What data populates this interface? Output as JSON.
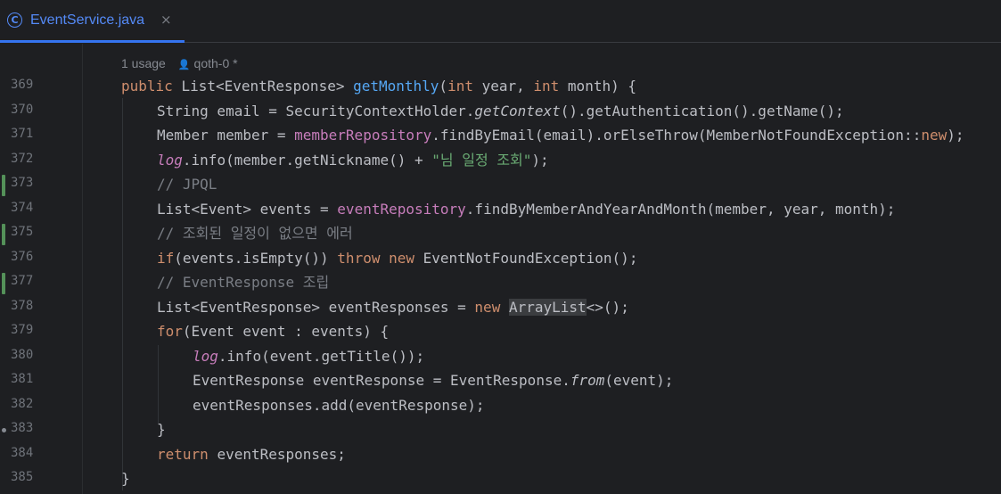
{
  "tab": {
    "icon_letter": "C",
    "title": "EventService.java",
    "close": "×"
  },
  "hint": {
    "usages": "1 usage",
    "person_icon": "person-icon",
    "author": "qoth-0 *"
  },
  "lines": {
    "l369": {
      "n": "369",
      "s1": "public ",
      "s2": "List<EventResponse> ",
      "s3": "getMonthly",
      "s4": "(",
      "s5": "int ",
      "s6": "year, ",
      "s7": "int ",
      "s8": "month) {"
    },
    "l370": {
      "n": "370",
      "s1": "String email = SecurityContextHolder.",
      "s2": "getContext",
      "s3": "().getAuthentication().getName();"
    },
    "l371": {
      "n": "371",
      "s1": "Member member = ",
      "s2": "memberRepository",
      "s3": ".findByEmail(email).orElseThrow(MemberNotFoundException::",
      "s4": "new",
      "s5": ");"
    },
    "l372": {
      "n": "372",
      "s1": "log",
      "s2": ".info(member.getNickname() + ",
      "s3": "\"님 일정 조회\"",
      "s4": ");"
    },
    "l373": {
      "n": "373",
      "s1": "// JPQL"
    },
    "l374": {
      "n": "374",
      "s1": "List<Event> events = ",
      "s2": "eventRepository",
      "s3": ".findByMemberAndYearAndMonth(member, year, month);"
    },
    "l375": {
      "n": "375",
      "s1": "// 조회된 일정이 없으면 에러"
    },
    "l376": {
      "n": "376",
      "s1": "if",
      "s2": "(events.isEmpty()) ",
      "s3": "throw ",
      "s4": "new ",
      "s5": "EventNotFoundException();"
    },
    "l377": {
      "n": "377",
      "s1": "// EventResponse 조립"
    },
    "l378": {
      "n": "378",
      "s1": "List<EventResponse> eventResponses = ",
      "s2": "new ",
      "s3": "ArrayList",
      "s4": "<>();"
    },
    "l379": {
      "n": "379",
      "s1": "for",
      "s2": "(Event event : events) {"
    },
    "l380": {
      "n": "380",
      "s1": "log",
      "s2": ".info(event.getTitle());"
    },
    "l381": {
      "n": "381",
      "s1": "EventResponse eventResponse = EventResponse.",
      "s2": "from",
      "s3": "(event);"
    },
    "l382": {
      "n": "382",
      "s1": "eventResponses.add(eventResponse);"
    },
    "l383": {
      "n": "383",
      "s1": "}"
    },
    "l384": {
      "n": "384",
      "s1": "return ",
      "s2": "eventResponses;"
    },
    "l385": {
      "n": "385",
      "s1": "}"
    }
  },
  "colors": {
    "background": "#1e1f22",
    "keyword": "#cf8e6d",
    "method_declaration": "#56a8f5",
    "field": "#c77dbb",
    "string": "#6aab73",
    "comment": "#7a7e85",
    "line_number": "#6f737a",
    "vcs_modified": "#549159",
    "tab_accent": "#3574f0"
  }
}
